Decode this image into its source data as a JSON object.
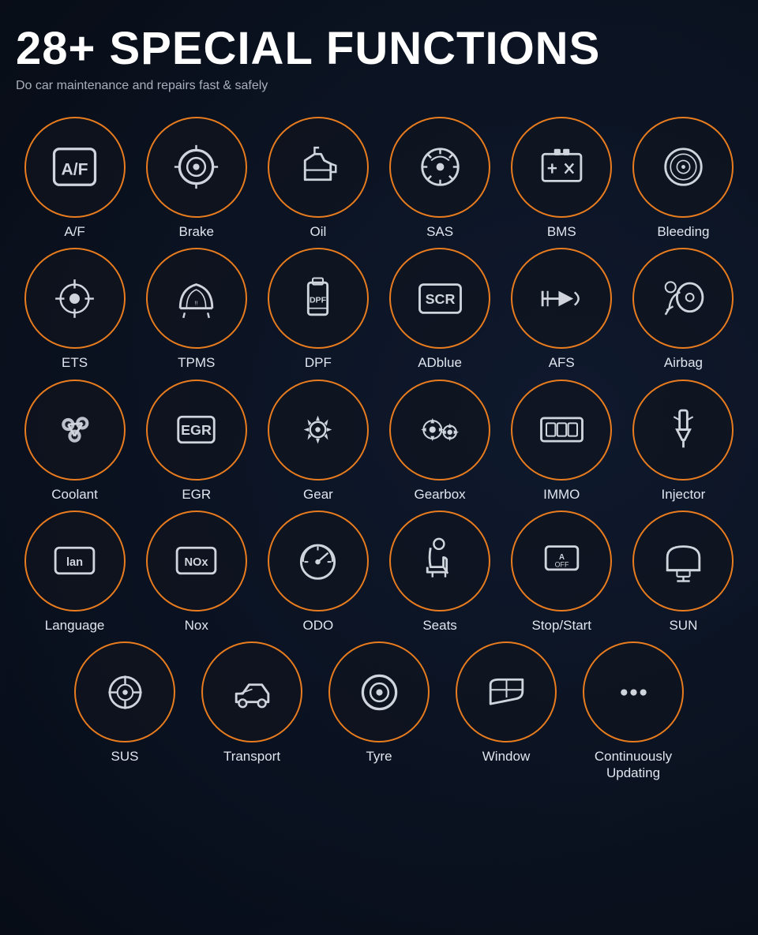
{
  "header": {
    "title": "28+ SPECIAL FUNCTIONS",
    "subtitle": "Do car maintenance and repairs  fast & safely"
  },
  "rows": [
    [
      {
        "label": "A/F",
        "icon": "af"
      },
      {
        "label": "Brake",
        "icon": "brake"
      },
      {
        "label": "Oil",
        "icon": "oil"
      },
      {
        "label": "SAS",
        "icon": "sas"
      },
      {
        "label": "BMS",
        "icon": "bms"
      },
      {
        "label": "Bleeding",
        "icon": "bleeding"
      }
    ],
    [
      {
        "label": "ETS",
        "icon": "ets"
      },
      {
        "label": "TPMS",
        "icon": "tpms"
      },
      {
        "label": "DPF",
        "icon": "dpf"
      },
      {
        "label": "ADblue",
        "icon": "adblue"
      },
      {
        "label": "AFS",
        "icon": "afs"
      },
      {
        "label": "Airbag",
        "icon": "airbag"
      }
    ],
    [
      {
        "label": "Coolant",
        "icon": "coolant"
      },
      {
        "label": "EGR",
        "icon": "egr"
      },
      {
        "label": "Gear",
        "icon": "gear"
      },
      {
        "label": "Gearbox",
        "icon": "gearbox"
      },
      {
        "label": "IMMO",
        "icon": "immo"
      },
      {
        "label": "Injector",
        "icon": "injector"
      }
    ],
    [
      {
        "label": "Language",
        "icon": "language"
      },
      {
        "label": "Nox",
        "icon": "nox"
      },
      {
        "label": "ODO",
        "icon": "odo"
      },
      {
        "label": "Seats",
        "icon": "seats"
      },
      {
        "label": "Stop/Start",
        "icon": "stopstart"
      },
      {
        "label": "SUN",
        "icon": "sun"
      }
    ],
    [
      {
        "label": "SUS",
        "icon": "sus"
      },
      {
        "label": "Transport",
        "icon": "transport"
      },
      {
        "label": "Tyre",
        "icon": "tyre"
      },
      {
        "label": "Window",
        "icon": "window"
      },
      {
        "label": "Continuously\nUpdating",
        "icon": "updating"
      }
    ]
  ]
}
